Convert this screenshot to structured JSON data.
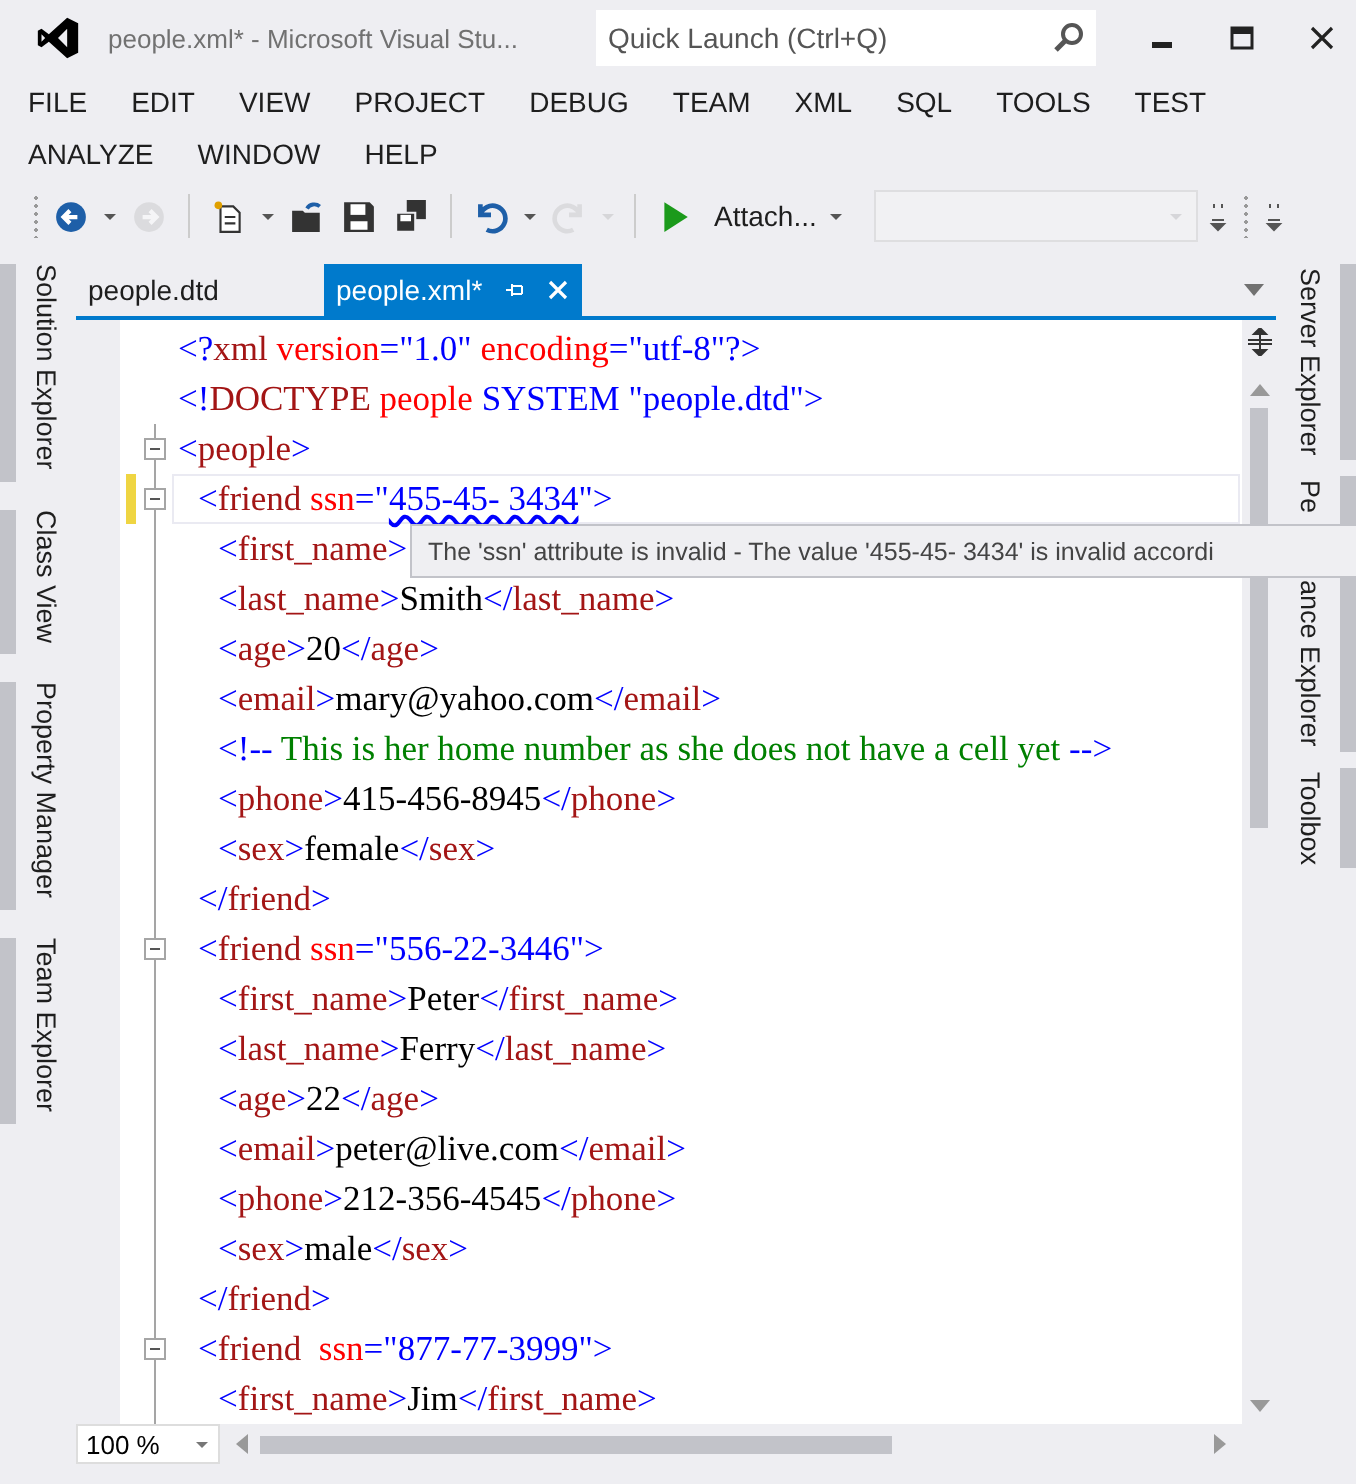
{
  "window": {
    "title": "people.xml* - Microsoft Visual Stu...",
    "quick_launch": {
      "placeholder": "Quick Launch (Ctrl+Q)"
    }
  },
  "menu": [
    "FILE",
    "EDIT",
    "VIEW",
    "PROJECT",
    "DEBUG",
    "TEAM",
    "XML",
    "SQL",
    "TOOLS",
    "TEST",
    "ANALYZE",
    "WINDOW",
    "HELP"
  ],
  "toolbar": [
    {
      "kind": "back",
      "disabled": false
    },
    {
      "kind": "caret",
      "disabled": false
    },
    {
      "kind": "forward",
      "disabled": true
    },
    {
      "kind": "separator"
    },
    {
      "kind": "new",
      "disabled": false
    },
    {
      "kind": "caret",
      "disabled": false
    },
    {
      "kind": "open",
      "disabled": false
    },
    {
      "kind": "save",
      "disabled": false
    },
    {
      "kind": "save-all",
      "disabled": false
    },
    {
      "kind": "separator"
    },
    {
      "kind": "undo",
      "disabled": false
    },
    {
      "kind": "caret",
      "disabled": false
    },
    {
      "kind": "redo",
      "disabled": true
    },
    {
      "kind": "caret",
      "disabled": true
    },
    {
      "kind": "separator"
    },
    {
      "kind": "play",
      "disabled": false
    },
    {
      "kind": "attach",
      "label": "Attach...",
      "disabled": false
    },
    {
      "kind": "combo",
      "disabled": true
    }
  ],
  "left_panels": [
    "Solution Explorer",
    "Class View",
    "Property Manager",
    "Team Explorer"
  ],
  "right_panels": [
    {
      "label": "Server Explorer"
    },
    {
      "label": "Pe",
      "label_rest": "ance Explorer"
    },
    {
      "label": "Toolbox"
    }
  ],
  "tabs": [
    {
      "label": "people.dtd",
      "selected": false
    },
    {
      "label": "people.xml*",
      "selected": true
    }
  ],
  "editor": {
    "lines": [
      {
        "tokens": [
          {
            "kind": "punct",
            "text": "<?"
          },
          {
            "kind": "tag",
            "text": "xml"
          },
          {
            "kind": "attr",
            "text": " version"
          },
          {
            "kind": "punct",
            "text": "=\""
          },
          {
            "kind": "value",
            "text": "1.0"
          },
          {
            "kind": "punct",
            "text": "\""
          },
          {
            "kind": "attr",
            "text": " encoding"
          },
          {
            "kind": "punct",
            "text": "=\""
          },
          {
            "kind": "value",
            "text": "utf-8"
          },
          {
            "kind": "punct",
            "text": "\"?>"
          }
        ]
      },
      {
        "tokens": [
          {
            "kind": "punct",
            "text": "<!"
          },
          {
            "kind": "tag",
            "text": "DOCTYPE"
          },
          {
            "kind": "attr",
            "text": " people"
          },
          {
            "kind": "punct",
            "text": " SYSTEM \""
          },
          {
            "kind": "value",
            "text": "people.dtd"
          },
          {
            "kind": "punct",
            "text": "\">"
          }
        ]
      },
      {
        "expanded": true,
        "tokens": [
          {
            "kind": "punct",
            "text": "<"
          },
          {
            "kind": "tag",
            "text": "people"
          },
          {
            "kind": "punct",
            "text": ">"
          }
        ],
        "children": [
          {
            "expanded": true,
            "current": true,
            "changed": true,
            "tokens": [
              {
                "kind": "punct",
                "text": "<"
              },
              {
                "kind": "tag",
                "text": "friend"
              },
              {
                "kind": "attr",
                "text": " ssn"
              },
              {
                "kind": "punct",
                "text": "=\""
              },
              {
                "kind": "value",
                "text": "455-45- 3434",
                "error": true
              },
              {
                "kind": "punct",
                "text": "\">"
              }
            ],
            "children": [
              {
                "tokens": [
                  {
                    "kind": "punct",
                    "text": "<"
                  },
                  {
                    "kind": "tag",
                    "text": "first_name"
                  },
                  {
                    "kind": "punct",
                    "text": ">"
                  }
                ]
              },
              {
                "tokens": [
                  {
                    "kind": "punct",
                    "text": "<"
                  },
                  {
                    "kind": "tag",
                    "text": "last_name"
                  },
                  {
                    "kind": "punct",
                    "text": ">"
                  },
                  {
                    "kind": "text",
                    "text": "Smith"
                  },
                  {
                    "kind": "punct",
                    "text": "</"
                  },
                  {
                    "kind": "tag",
                    "text": "last_name"
                  },
                  {
                    "kind": "punct",
                    "text": ">"
                  }
                ]
              },
              {
                "tokens": [
                  {
                    "kind": "punct",
                    "text": "<"
                  },
                  {
                    "kind": "tag",
                    "text": "age"
                  },
                  {
                    "kind": "punct",
                    "text": ">"
                  },
                  {
                    "kind": "text",
                    "text": "20"
                  },
                  {
                    "kind": "punct",
                    "text": "</"
                  },
                  {
                    "kind": "tag",
                    "text": "age"
                  },
                  {
                    "kind": "punct",
                    "text": ">"
                  }
                ]
              },
              {
                "tokens": [
                  {
                    "kind": "punct",
                    "text": "<"
                  },
                  {
                    "kind": "tag",
                    "text": "email"
                  },
                  {
                    "kind": "punct",
                    "text": ">"
                  },
                  {
                    "kind": "text",
                    "text": "mary@yahoo.com"
                  },
                  {
                    "kind": "punct",
                    "text": "</"
                  },
                  {
                    "kind": "tag",
                    "text": "email"
                  },
                  {
                    "kind": "punct",
                    "text": ">"
                  }
                ]
              },
              {
                "tokens": [
                  {
                    "kind": "punct",
                    "text": "<!--"
                  },
                  {
                    "kind": "comment",
                    "text": " This is her home number as she does not have a cell yet "
                  },
                  {
                    "kind": "punct",
                    "text": "-->"
                  }
                ]
              },
              {
                "tokens": [
                  {
                    "kind": "punct",
                    "text": "<"
                  },
                  {
                    "kind": "tag",
                    "text": "phone"
                  },
                  {
                    "kind": "punct",
                    "text": ">"
                  },
                  {
                    "kind": "text",
                    "text": "415-456-8945"
                  },
                  {
                    "kind": "punct",
                    "text": "</"
                  },
                  {
                    "kind": "tag",
                    "text": "phone"
                  },
                  {
                    "kind": "punct",
                    "text": ">"
                  }
                ]
              },
              {
                "tokens": [
                  {
                    "kind": "punct",
                    "text": "<"
                  },
                  {
                    "kind": "tag",
                    "text": "sex"
                  },
                  {
                    "kind": "punct",
                    "text": ">"
                  },
                  {
                    "kind": "text",
                    "text": "female"
                  },
                  {
                    "kind": "punct",
                    "text": "</"
                  },
                  {
                    "kind": "tag",
                    "text": "sex"
                  },
                  {
                    "kind": "punct",
                    "text": ">"
                  }
                ]
              }
            ]
          },
          {
            "tokens": [
              {
                "kind": "punct",
                "text": "</"
              },
              {
                "kind": "tag",
                "text": "friend"
              },
              {
                "kind": "punct",
                "text": ">"
              }
            ]
          },
          {
            "expanded": true,
            "tokens": [
              {
                "kind": "punct",
                "text": "<"
              },
              {
                "kind": "tag",
                "text": "friend"
              },
              {
                "kind": "attr",
                "text": " ssn"
              },
              {
                "kind": "punct",
                "text": "=\""
              },
              {
                "kind": "value",
                "text": "556-22-3446"
              },
              {
                "kind": "punct",
                "text": "\">"
              }
            ],
            "children": [
              {
                "tokens": [
                  {
                    "kind": "punct",
                    "text": "<"
                  },
                  {
                    "kind": "tag",
                    "text": "first_name"
                  },
                  {
                    "kind": "punct",
                    "text": ">"
                  },
                  {
                    "kind": "text",
                    "text": "Peter"
                  },
                  {
                    "kind": "punct",
                    "text": "</"
                  },
                  {
                    "kind": "tag",
                    "text": "first_name"
                  },
                  {
                    "kind": "punct",
                    "text": ">"
                  }
                ]
              },
              {
                "tokens": [
                  {
                    "kind": "punct",
                    "text": "<"
                  },
                  {
                    "kind": "tag",
                    "text": "last_name"
                  },
                  {
                    "kind": "punct",
                    "text": ">"
                  },
                  {
                    "kind": "text",
                    "text": "Ferry"
                  },
                  {
                    "kind": "punct",
                    "text": "</"
                  },
                  {
                    "kind": "tag",
                    "text": "last_name"
                  },
                  {
                    "kind": "punct",
                    "text": ">"
                  }
                ]
              },
              {
                "tokens": [
                  {
                    "kind": "punct",
                    "text": "<"
                  },
                  {
                    "kind": "tag",
                    "text": "age"
                  },
                  {
                    "kind": "punct",
                    "text": ">"
                  },
                  {
                    "kind": "text",
                    "text": "22"
                  },
                  {
                    "kind": "punct",
                    "text": "</"
                  },
                  {
                    "kind": "tag",
                    "text": "age"
                  },
                  {
                    "kind": "punct",
                    "text": ">"
                  }
                ]
              },
              {
                "tokens": [
                  {
                    "kind": "punct",
                    "text": "<"
                  },
                  {
                    "kind": "tag",
                    "text": "email"
                  },
                  {
                    "kind": "punct",
                    "text": ">"
                  },
                  {
                    "kind": "text",
                    "text": "peter@live.com"
                  },
                  {
                    "kind": "punct",
                    "text": "</"
                  },
                  {
                    "kind": "tag",
                    "text": "email"
                  },
                  {
                    "kind": "punct",
                    "text": ">"
                  }
                ]
              },
              {
                "tokens": [
                  {
                    "kind": "punct",
                    "text": "<"
                  },
                  {
                    "kind": "tag",
                    "text": "phone"
                  },
                  {
                    "kind": "punct",
                    "text": ">"
                  },
                  {
                    "kind": "text",
                    "text": "212-356-4545"
                  },
                  {
                    "kind": "punct",
                    "text": "</"
                  },
                  {
                    "kind": "tag",
                    "text": "phone"
                  },
                  {
                    "kind": "punct",
                    "text": ">"
                  }
                ]
              },
              {
                "tokens": [
                  {
                    "kind": "punct",
                    "text": "<"
                  },
                  {
                    "kind": "tag",
                    "text": "sex"
                  },
                  {
                    "kind": "punct",
                    "text": ">"
                  },
                  {
                    "kind": "text",
                    "text": "male"
                  },
                  {
                    "kind": "punct",
                    "text": "</"
                  },
                  {
                    "kind": "tag",
                    "text": "sex"
                  },
                  {
                    "kind": "punct",
                    "text": ">"
                  }
                ]
              }
            ]
          },
          {
            "tokens": [
              {
                "kind": "punct",
                "text": "</"
              },
              {
                "kind": "tag",
                "text": "friend"
              },
              {
                "kind": "punct",
                "text": ">"
              }
            ]
          },
          {
            "expanded": true,
            "tokens": [
              {
                "kind": "punct",
                "text": "<"
              },
              {
                "kind": "tag",
                "text": "friend"
              },
              {
                "kind": "attr",
                "text": "  ssn"
              },
              {
                "kind": "punct",
                "text": "=\""
              },
              {
                "kind": "value",
                "text": "877-77-3999"
              },
              {
                "kind": "punct",
                "text": "\">"
              }
            ],
            "children": [
              {
                "tokens": [
                  {
                    "kind": "punct",
                    "text": "<"
                  },
                  {
                    "kind": "tag",
                    "text": "first_name"
                  },
                  {
                    "kind": "punct",
                    "text": ">"
                  },
                  {
                    "kind": "text",
                    "text": "Jim"
                  },
                  {
                    "kind": "punct",
                    "text": "</"
                  },
                  {
                    "kind": "tag",
                    "text": "first_name"
                  },
                  {
                    "kind": "punct",
                    "text": ">"
                  }
                ]
              }
            ]
          }
        ]
      }
    ]
  },
  "tooltip": "The 'ssn' attribute is invalid - The value '455-45- 3434' is invalid accordi",
  "zoom": "100 %"
}
